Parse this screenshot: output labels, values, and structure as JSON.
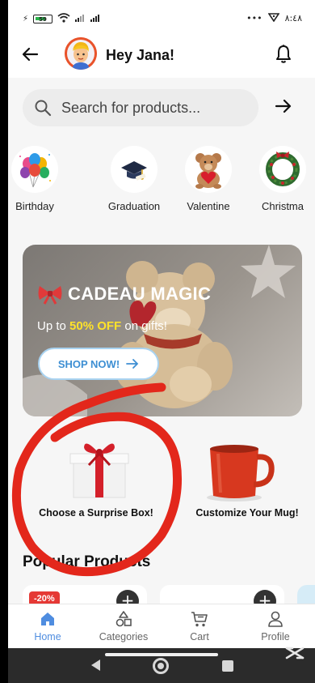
{
  "statusbar": {
    "battery": "59",
    "time_right": "٨:٤٨",
    "dots": "•••"
  },
  "header": {
    "greeting": "Hey Jana!",
    "icons": [
      "back-arrow-icon",
      "avatar",
      "bell-icon"
    ]
  },
  "search": {
    "placeholder": "Search for products..."
  },
  "categories": [
    {
      "label": "Birthday",
      "icon": "balloons"
    },
    {
      "label": "Graduation",
      "icon": "graduation-cap"
    },
    {
      "label": "Valentine",
      "icon": "teddy-bear"
    },
    {
      "label": "Christma",
      "icon": "wreath"
    }
  ],
  "banner": {
    "title": "CADEAU MAGIC",
    "sub_prefix": "Up to ",
    "sub_highlight": "50% OFF",
    "sub_suffix": " on gifts!",
    "button": "SHOP NOW!"
  },
  "promos": [
    {
      "label": "Choose a Surprise Box!",
      "icon": "gift-box"
    },
    {
      "label": "Customize Your Mug!",
      "icon": "mug"
    }
  ],
  "popular": {
    "title": "Popular Products",
    "discount": "-20%",
    "add": "+"
  },
  "nav": [
    {
      "label": "Home",
      "active": true
    },
    {
      "label": "Categories",
      "active": false
    },
    {
      "label": "Cart",
      "active": false
    },
    {
      "label": "Profile",
      "active": false
    }
  ],
  "colors": {
    "accent": "#4f8de0",
    "highlight": "#ffe22a",
    "discount": "#e53935",
    "scribble": "#e3271b"
  }
}
